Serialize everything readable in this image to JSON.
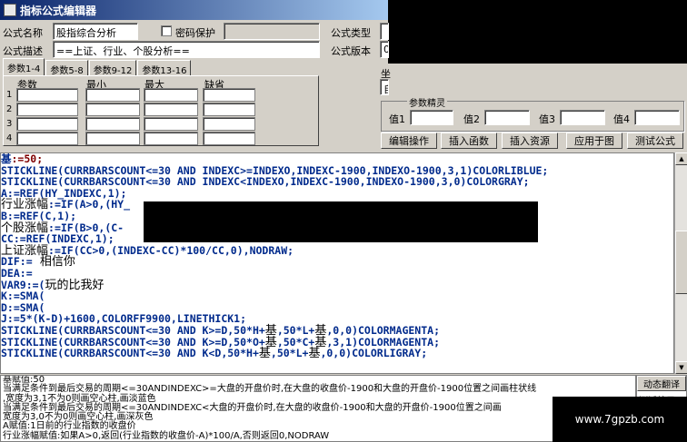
{
  "window": {
    "title": "指标公式编辑器"
  },
  "form": {
    "name_label": "公式名称",
    "name_value": "股指综合分析",
    "password_label": "密码保护",
    "type_label": "公式类型",
    "desc_label": "公式描述",
    "desc_value": "==上证、行业、个股分析==",
    "version_label": "公式版本",
    "version_value": "0"
  },
  "tabs": [
    "参数1-4",
    "参数5-8",
    "参数9-12",
    "参数13-16"
  ],
  "params": {
    "headers": [
      "参数",
      "最小",
      "最大",
      "缺省"
    ],
    "rows": [
      "1",
      "2",
      "3",
      "4"
    ]
  },
  "right_panel": {
    "label_partial": "坐",
    "combo_value": "自",
    "group_title": "参数精灵",
    "value_labels": [
      "值1",
      "值2",
      "值3",
      "值4"
    ]
  },
  "buttons": {
    "edit": "编辑操作",
    "insert_func": "插入函数",
    "insert_res": "插入资源",
    "apply": "应用于图",
    "test": "测试公式"
  },
  "code_lines": [
    [
      [
        "kw",
        "基"
      ],
      [
        "nm",
        ":=50;"
      ]
    ],
    [
      [
        "kw",
        "STICKLINE(CURRBARSCOUNT<=30 AND INDEXC>=INDEXO,INDEXC-1900,INDEXO-1900,3,1)COLORLIBLUE;"
      ]
    ],
    [
      [
        "kw",
        "STICKLINE(CURRBARSCOUNT<=30 AND INDEXC<INDEXO,INDEXC-1900,INDEXO-1900,3,0)COLORGRAY;"
      ]
    ],
    [
      [
        "kw",
        "A:=REF(HY_INDEXC,1);"
      ]
    ],
    [
      [
        "cn",
        "行业涨幅"
      ],
      [
        "kw",
        ":=IF(A>0,(HY_"
      ]
    ],
    [
      [
        "kw",
        "B:=REF(C,1);"
      ]
    ],
    [
      [
        "cn",
        "个股涨幅"
      ],
      [
        "kw",
        ":=IF(B>0,(C-"
      ]
    ],
    [
      [
        "kw",
        "CC:=REF(INDEXC,1);"
      ]
    ],
    [
      [
        "cn",
        "上证涨幅"
      ],
      [
        "kw",
        ":=IF(CC>0,(INDEXC-CC)*100/CC,0),NODRAW;"
      ]
    ],
    [
      [
        "kw",
        "DIF:="
      ],
      [
        "cn",
        "  相信你"
      ]
    ],
    [
      [
        "kw",
        "DEA:="
      ]
    ],
    [
      [
        "kw",
        "VAR9:=("
      ],
      [
        "cn",
        "玩的比我好"
      ]
    ],
    [
      [
        "kw",
        "K:=SMA("
      ]
    ],
    [
      [
        "kw",
        "D:=SMA("
      ]
    ],
    [
      [
        "kw",
        "J:=5*(K-D)+1600,COLORFF9900,LINETHICK1;"
      ]
    ],
    [
      [
        "kw",
        "STICKLINE(CURRBARSCOUNT<=30 AND K>=D,50*H+"
      ],
      [
        "cn",
        "基"
      ],
      [
        "kw",
        ",50*L+"
      ],
      [
        "cn",
        "基"
      ],
      [
        "kw",
        ",0,0)COLORMAGENTA;"
      ]
    ],
    [
      [
        "kw",
        "STICKLINE(CURRBARSCOUNT<=30 AND K>=D,50*O+"
      ],
      [
        "cn",
        "基"
      ],
      [
        "kw",
        ",50*C+"
      ],
      [
        "cn",
        "基"
      ],
      [
        "kw",
        ",3,1)COLORMAGENTA;"
      ]
    ],
    [
      [
        "kw",
        "STICKLINE(CURRBARSCOUNT<=30 AND K<D,50*H+"
      ],
      [
        "cn",
        "基"
      ],
      [
        "kw",
        ",50*L+"
      ],
      [
        "cn",
        "基"
      ],
      [
        "kw",
        ",0,0)COLORLIGRAY;"
      ]
    ]
  ],
  "description": [
    "基赋值:50",
    "当满足条件到最后交易的周期<=30ANDINDEXC>=大盘的开盘价时,在大盘的收盘价-1900和大盘的开盘价-1900位置之间画柱状线",
    ",宽度为3,1不为0则画空心柱,画淡蓝色",
    "当满足条件到最后交易的周期<=30ANDINDEXC<大盘的开盘价时,在大盘的收盘价-1900和大盘的开盘价-1900位置之间画",
    "宽度为3,0不为0则画空心柱,画深灰色",
    "A赋值:1日前的行业指数的收盘价",
    "行业涨幅赋值:如果A>0,返回(行业指数的收盘价-A)*100/A,否则返回0,NODRAW"
  ],
  "side": {
    "translate": "动态翻译",
    "test_result": "测试结果"
  },
  "watermark": "www.7gpzb.com"
}
